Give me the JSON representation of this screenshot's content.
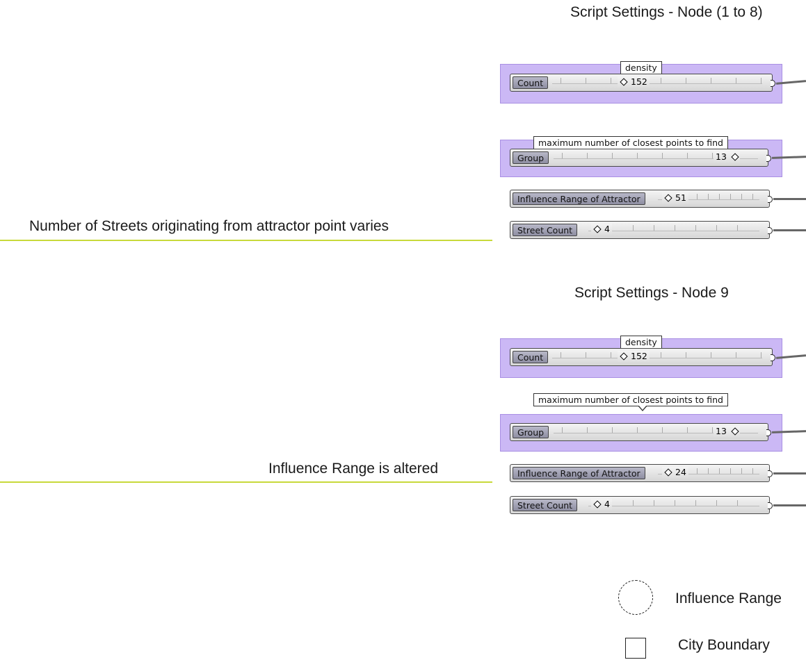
{
  "headings": {
    "top": "Script Settings - Node  (1 to 8)",
    "bottom": "Script Settings - Node  9"
  },
  "annotations": {
    "streets": "Number of Streets originating from attractor point varies",
    "influence": "Influence Range is altered"
  },
  "panel_top": {
    "count": {
      "callout": "density",
      "label": "Count",
      "value": "152"
    },
    "group": {
      "callout": "maximum number of closest points to find",
      "label": "Group",
      "value": "13"
    },
    "influence": {
      "label": "Influence Range of Attractor",
      "value": "51"
    },
    "street": {
      "label": "Street Count",
      "value": "4"
    }
  },
  "panel_bottom": {
    "count": {
      "callout": "density",
      "label": "Count",
      "value": "152"
    },
    "group": {
      "callout": "maximum number of closest points to find",
      "label": "Group",
      "value": "13"
    },
    "influence": {
      "label": "Influence Range of Attractor",
      "value": "24"
    },
    "street": {
      "label": "Street Count",
      "value": "4"
    }
  },
  "legend": {
    "influence_range": "Influence Range",
    "city_boundary": "City Boundary"
  },
  "colors": {
    "group_fill": "#cbb8f5",
    "annotation_underline": "#c8d93a",
    "slider_label": "#8e8ea2"
  }
}
